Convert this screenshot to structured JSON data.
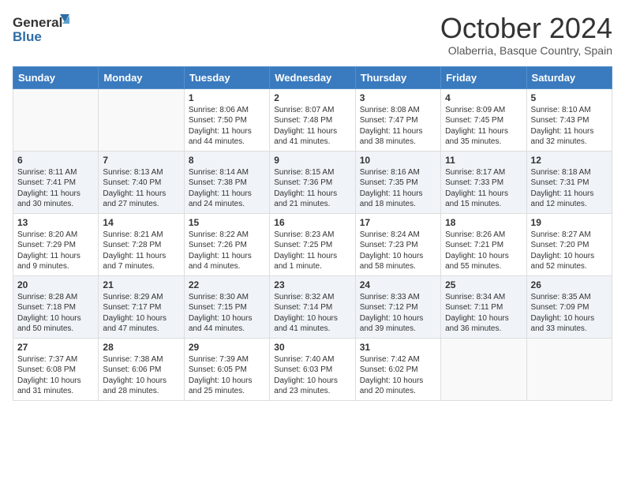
{
  "header": {
    "logo_general": "General",
    "logo_blue": "Blue",
    "month": "October 2024",
    "location": "Olaberria, Basque Country, Spain"
  },
  "weekdays": [
    "Sunday",
    "Monday",
    "Tuesday",
    "Wednesday",
    "Thursday",
    "Friday",
    "Saturday"
  ],
  "weeks": [
    [
      {
        "day": "",
        "info": ""
      },
      {
        "day": "",
        "info": ""
      },
      {
        "day": "1",
        "info": "Sunrise: 8:06 AM\nSunset: 7:50 PM\nDaylight: 11 hours and 44 minutes."
      },
      {
        "day": "2",
        "info": "Sunrise: 8:07 AM\nSunset: 7:48 PM\nDaylight: 11 hours and 41 minutes."
      },
      {
        "day": "3",
        "info": "Sunrise: 8:08 AM\nSunset: 7:47 PM\nDaylight: 11 hours and 38 minutes."
      },
      {
        "day": "4",
        "info": "Sunrise: 8:09 AM\nSunset: 7:45 PM\nDaylight: 11 hours and 35 minutes."
      },
      {
        "day": "5",
        "info": "Sunrise: 8:10 AM\nSunset: 7:43 PM\nDaylight: 11 hours and 32 minutes."
      }
    ],
    [
      {
        "day": "6",
        "info": "Sunrise: 8:11 AM\nSunset: 7:41 PM\nDaylight: 11 hours and 30 minutes."
      },
      {
        "day": "7",
        "info": "Sunrise: 8:13 AM\nSunset: 7:40 PM\nDaylight: 11 hours and 27 minutes."
      },
      {
        "day": "8",
        "info": "Sunrise: 8:14 AM\nSunset: 7:38 PM\nDaylight: 11 hours and 24 minutes."
      },
      {
        "day": "9",
        "info": "Sunrise: 8:15 AM\nSunset: 7:36 PM\nDaylight: 11 hours and 21 minutes."
      },
      {
        "day": "10",
        "info": "Sunrise: 8:16 AM\nSunset: 7:35 PM\nDaylight: 11 hours and 18 minutes."
      },
      {
        "day": "11",
        "info": "Sunrise: 8:17 AM\nSunset: 7:33 PM\nDaylight: 11 hours and 15 minutes."
      },
      {
        "day": "12",
        "info": "Sunrise: 8:18 AM\nSunset: 7:31 PM\nDaylight: 11 hours and 12 minutes."
      }
    ],
    [
      {
        "day": "13",
        "info": "Sunrise: 8:20 AM\nSunset: 7:29 PM\nDaylight: 11 hours and 9 minutes."
      },
      {
        "day": "14",
        "info": "Sunrise: 8:21 AM\nSunset: 7:28 PM\nDaylight: 11 hours and 7 minutes."
      },
      {
        "day": "15",
        "info": "Sunrise: 8:22 AM\nSunset: 7:26 PM\nDaylight: 11 hours and 4 minutes."
      },
      {
        "day": "16",
        "info": "Sunrise: 8:23 AM\nSunset: 7:25 PM\nDaylight: 11 hours and 1 minute."
      },
      {
        "day": "17",
        "info": "Sunrise: 8:24 AM\nSunset: 7:23 PM\nDaylight: 10 hours and 58 minutes."
      },
      {
        "day": "18",
        "info": "Sunrise: 8:26 AM\nSunset: 7:21 PM\nDaylight: 10 hours and 55 minutes."
      },
      {
        "day": "19",
        "info": "Sunrise: 8:27 AM\nSunset: 7:20 PM\nDaylight: 10 hours and 52 minutes."
      }
    ],
    [
      {
        "day": "20",
        "info": "Sunrise: 8:28 AM\nSunset: 7:18 PM\nDaylight: 10 hours and 50 minutes."
      },
      {
        "day": "21",
        "info": "Sunrise: 8:29 AM\nSunset: 7:17 PM\nDaylight: 10 hours and 47 minutes."
      },
      {
        "day": "22",
        "info": "Sunrise: 8:30 AM\nSunset: 7:15 PM\nDaylight: 10 hours and 44 minutes."
      },
      {
        "day": "23",
        "info": "Sunrise: 8:32 AM\nSunset: 7:14 PM\nDaylight: 10 hours and 41 minutes."
      },
      {
        "day": "24",
        "info": "Sunrise: 8:33 AM\nSunset: 7:12 PM\nDaylight: 10 hours and 39 minutes."
      },
      {
        "day": "25",
        "info": "Sunrise: 8:34 AM\nSunset: 7:11 PM\nDaylight: 10 hours and 36 minutes."
      },
      {
        "day": "26",
        "info": "Sunrise: 8:35 AM\nSunset: 7:09 PM\nDaylight: 10 hours and 33 minutes."
      }
    ],
    [
      {
        "day": "27",
        "info": "Sunrise: 7:37 AM\nSunset: 6:08 PM\nDaylight: 10 hours and 31 minutes."
      },
      {
        "day": "28",
        "info": "Sunrise: 7:38 AM\nSunset: 6:06 PM\nDaylight: 10 hours and 28 minutes."
      },
      {
        "day": "29",
        "info": "Sunrise: 7:39 AM\nSunset: 6:05 PM\nDaylight: 10 hours and 25 minutes."
      },
      {
        "day": "30",
        "info": "Sunrise: 7:40 AM\nSunset: 6:03 PM\nDaylight: 10 hours and 23 minutes."
      },
      {
        "day": "31",
        "info": "Sunrise: 7:42 AM\nSunset: 6:02 PM\nDaylight: 10 hours and 20 minutes."
      },
      {
        "day": "",
        "info": ""
      },
      {
        "day": "",
        "info": ""
      }
    ]
  ]
}
